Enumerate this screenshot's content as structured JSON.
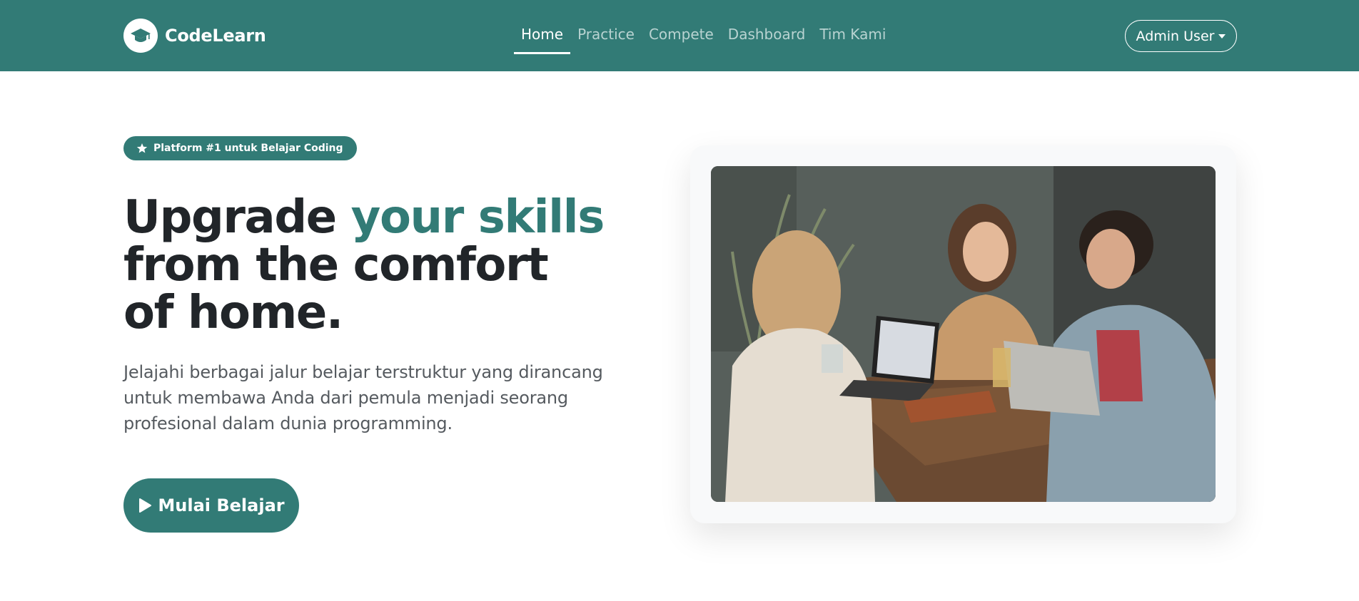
{
  "brand": {
    "name": "CodeLearn",
    "logo_icon": "graduation-cap-icon"
  },
  "nav": {
    "items": [
      {
        "label": "Home",
        "active": true
      },
      {
        "label": "Practice",
        "active": false
      },
      {
        "label": "Compete",
        "active": false
      },
      {
        "label": "Dashboard",
        "active": false
      },
      {
        "label": "Tim Kami",
        "active": false
      }
    ],
    "user_label": "Admin User"
  },
  "hero": {
    "badge_icon": "star-icon",
    "badge_text": "Platform #1 untuk Belajar Coding",
    "headline_part1": "Upgrade ",
    "headline_accent": "your skills",
    "headline_line2": "from the comfort",
    "headline_line3": "of home.",
    "subtext": "Jelajahi berbagai jalur belajar terstruktur yang dirancang untuk membawa Anda dari pemula menjadi seorang profesional dalam dunia programming.",
    "cta_icon": "play-icon",
    "cta_label": "Mulai Belajar"
  },
  "colors": {
    "primary": "#327b76",
    "text_dark": "#212529",
    "text_muted": "#555a5f",
    "nav_inactive": "#b8d3d1"
  }
}
